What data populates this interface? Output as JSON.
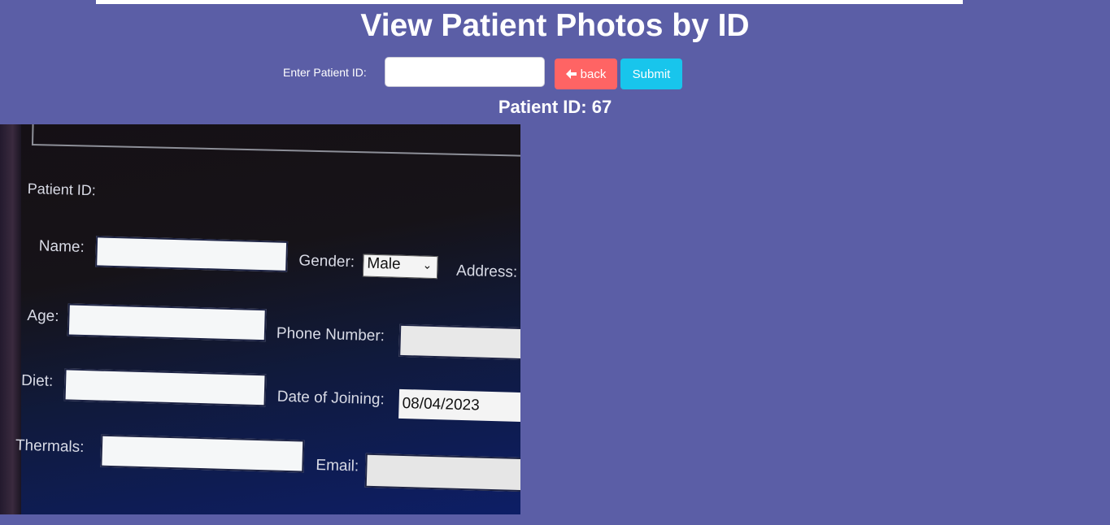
{
  "header": {
    "title": "View Patient Photos by ID"
  },
  "search": {
    "label": "Enter Patient ID:",
    "value": "",
    "placeholder": ""
  },
  "buttons": {
    "back_label": "back",
    "back_icon": "arrow-left-icon",
    "submit_label": "Submit"
  },
  "result": {
    "patient_id_text": "Patient ID: 67"
  },
  "photo": {
    "form_labels": {
      "patient_id": "Patient ID:",
      "name": "Name:",
      "gender": "Gender:",
      "gender_value": "Male",
      "address": "Address:",
      "age": "Age:",
      "phone": "Phone Number:",
      "diet": "Diet:",
      "date_of_joining": "Date of Joining:",
      "date_value": "08/04/2023",
      "thermals": "Thermals:",
      "email": "Email:"
    }
  },
  "colors": {
    "background": "#5b5ea6",
    "back_button": "#ff6464",
    "submit_button": "#18c5ec"
  }
}
